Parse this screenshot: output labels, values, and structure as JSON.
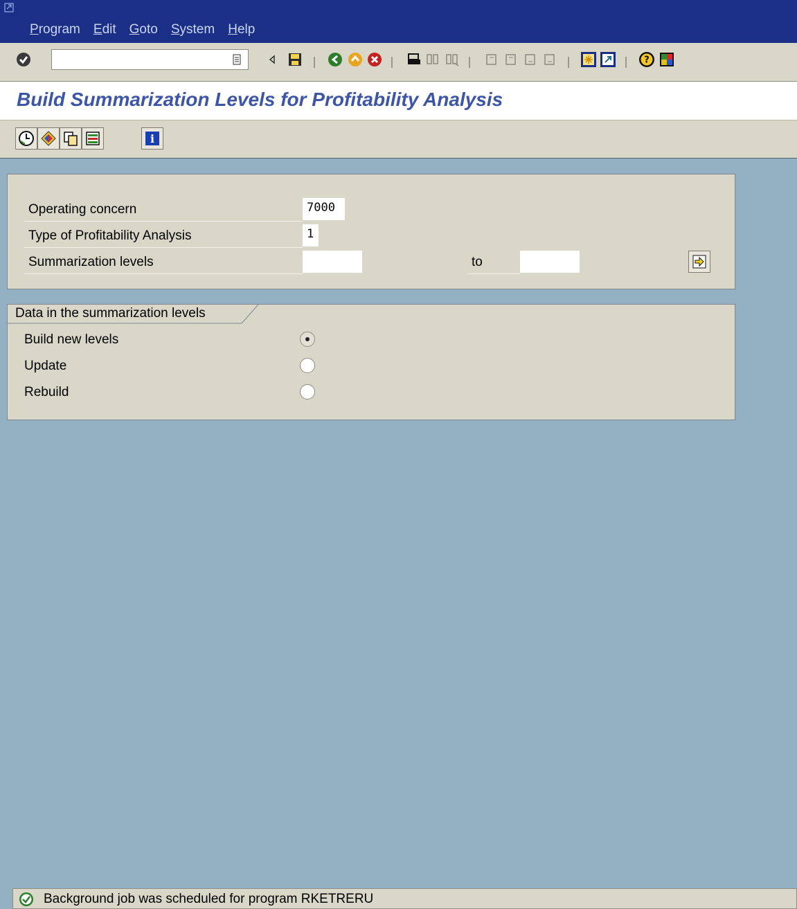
{
  "menu": {
    "items": [
      "Program",
      "Edit",
      "Goto",
      "System",
      "Help"
    ]
  },
  "toolbar": {
    "command_value": "",
    "icons": [
      "enter-icon",
      "save-icon",
      "back-icon",
      "exit-icon",
      "cancel-icon",
      "print-icon",
      "find-icon",
      "find-next-icon",
      "first-page-icon",
      "previous-page-icon",
      "next-page-icon",
      "last-page-icon",
      "create-session-icon",
      "shortcut-icon",
      "help-icon",
      "customize-layout-icon"
    ]
  },
  "title": "Build Summarization Levels for Profitability Analysis",
  "app_toolbar": {
    "icons": [
      "execute-in-background-icon",
      "variant-icon",
      "copy-icon",
      "selection-options-icon",
      "info-icon"
    ]
  },
  "selection": {
    "operating_concern_label": "Operating concern",
    "operating_concern_value": "7000",
    "type_label": "Type of Profitability Analysis",
    "type_value": "1",
    "summarization_label": "Summarization levels",
    "summarization_from": "",
    "to_label": "to",
    "summarization_to": ""
  },
  "data_group": {
    "title": "Data in the summarization levels",
    "options": [
      {
        "label": "Build new levels",
        "selected": true
      },
      {
        "label": "Update",
        "selected": false
      },
      {
        "label": "Rebuild",
        "selected": false
      }
    ]
  },
  "status": {
    "message": "Background job was scheduled for program RKETRERU",
    "type": "success"
  },
  "colors": {
    "menubar": "#1b2f87",
    "background": "#94b0c3",
    "title": "#3d55a6",
    "panel": "#d9d7c8"
  }
}
